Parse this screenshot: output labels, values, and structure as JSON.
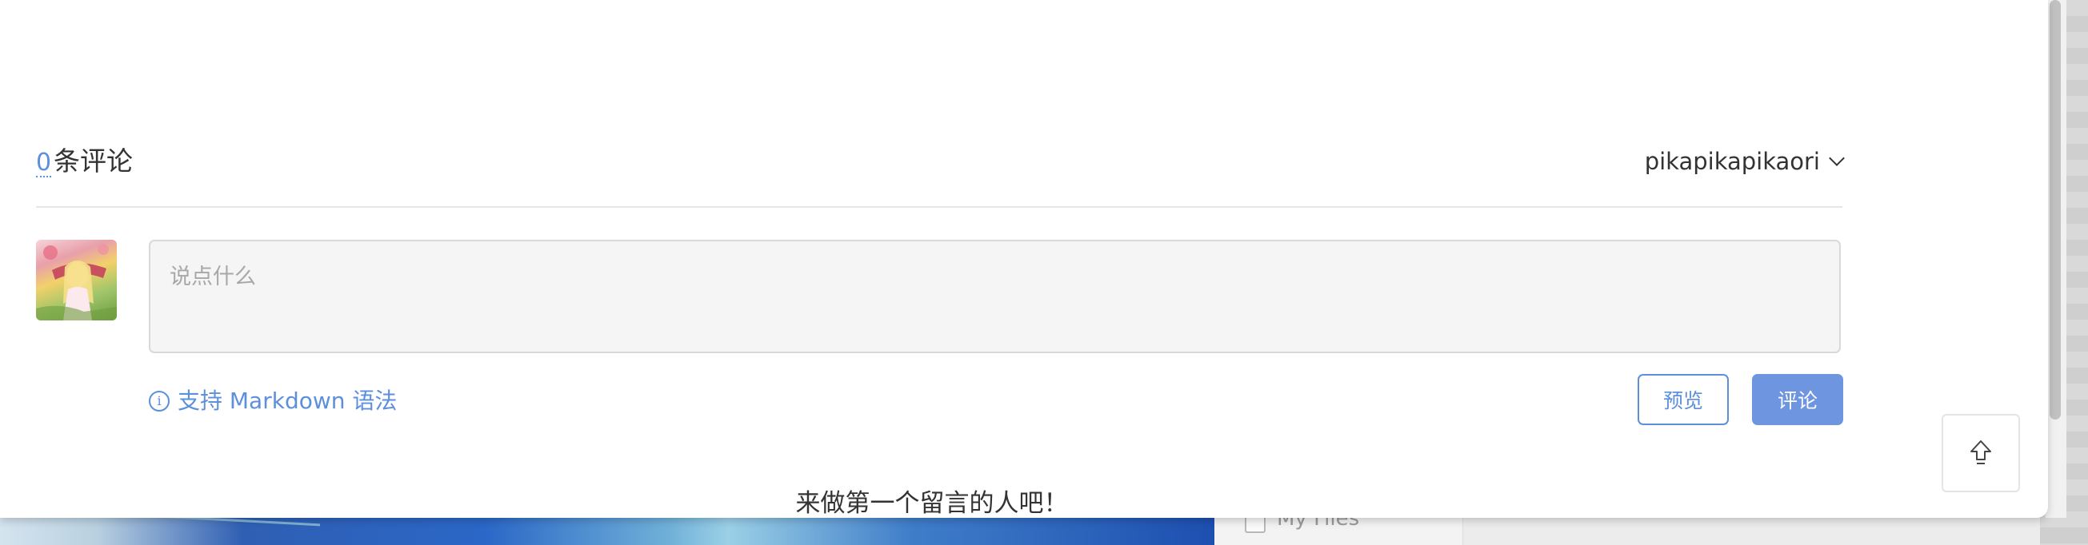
{
  "comments": {
    "count": "0",
    "count_label": "条评论",
    "username": "pikapikapikaori",
    "textarea_placeholder": "说点什么",
    "markdown_hint": "支持 Markdown 语法",
    "preview_label": "预览",
    "submit_label": "评论",
    "empty_message": "来做第一个留言的人吧！"
  },
  "background": {
    "file_label": "My Files"
  },
  "icons": {
    "user_menu": "chevron-down-icon",
    "hint": "info-icon",
    "back_to_top": "arrow-up-icon"
  },
  "colors": {
    "accent": "#5c8fdc",
    "submit_button": "#6d95e0",
    "text": "#333333",
    "placeholder": "#a8a8a8"
  }
}
